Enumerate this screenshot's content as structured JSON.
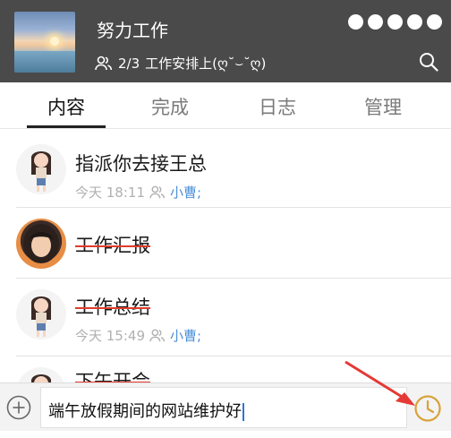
{
  "header": {
    "title": "努力工作",
    "member_count": "2/3",
    "subtitle": "工作安排上(ღ˘⌣˘ღ)",
    "menu_dots": [
      "dot1",
      "dot2",
      "dot3",
      "dot4",
      "dot5"
    ],
    "icons": [
      "people-icon",
      "search-icon"
    ]
  },
  "tabs": [
    {
      "label": "内容",
      "active": true
    },
    {
      "label": "完成",
      "active": false
    },
    {
      "label": "日志",
      "active": false
    },
    {
      "label": "管理",
      "active": false
    }
  ],
  "tasks": [
    {
      "title": "指派你去接王总",
      "time": "今天 18:11",
      "assignee": "小曹;",
      "done": false,
      "avatar": "cartoon-girl"
    },
    {
      "title": "工作汇报",
      "time": "",
      "assignee": "",
      "done": true,
      "avatar": "photo-person"
    },
    {
      "title": "工作总结",
      "time": "今天 15:49",
      "assignee": "小曹;",
      "done": true,
      "avatar": "cartoon-girl"
    },
    {
      "title": "下午开会",
      "time": "",
      "assignee": "",
      "done": true,
      "avatar": "cartoon-girl"
    }
  ],
  "input_bar": {
    "value": "端午放假期间的网站维护好",
    "icons": [
      "add-circle-icon",
      "clock-icon"
    ]
  },
  "colors": {
    "header_bg": "#4a4a4a",
    "assignee": "#4d8fd6",
    "strike": "#e03b2b",
    "clock": "#d9a23a",
    "arrow": "#e53935"
  }
}
